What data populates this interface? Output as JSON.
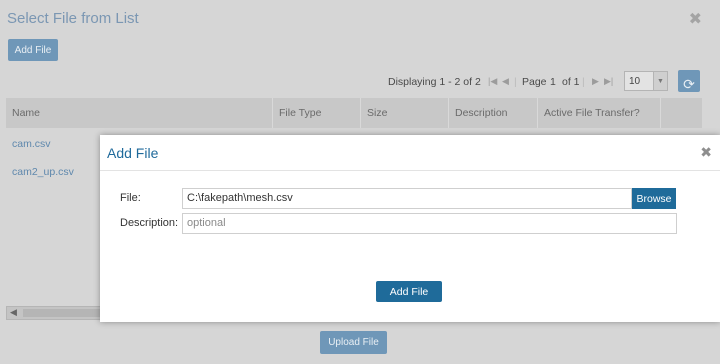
{
  "background_dialog": {
    "title": "Select File from List",
    "close_glyph": "✖",
    "add_file_label": "Add File",
    "upload_label": "Upload File",
    "pager": {
      "displaying": "Displaying 1 - 2 of 2",
      "page_label": "Page",
      "page_value": "1",
      "of_label": "of 1",
      "rows_per_page": "10",
      "icons": [
        "first-page-icon",
        "prev-page-icon",
        "next-page-icon",
        "last-page-icon",
        "refresh-icon"
      ]
    },
    "table": {
      "columns": [
        "Name",
        "File Type",
        "Size",
        "Description",
        "Active File Transfer?"
      ],
      "rows": [
        {
          "name": "cam.csv"
        },
        {
          "name": "cam2_up.csv"
        }
      ]
    }
  },
  "modal": {
    "title": "Add File",
    "close_glyph": "✖",
    "file_label": "File:",
    "file_value": "C:\\fakepath\\mesh.csv",
    "browse_label": "Browse",
    "description_label": "Description:",
    "description_placeholder": "optional",
    "submit_label": "Add File"
  },
  "colors": {
    "accent": "#1f6b9a",
    "muted_accent": "#6f97b8",
    "link": "#5f88ad"
  }
}
